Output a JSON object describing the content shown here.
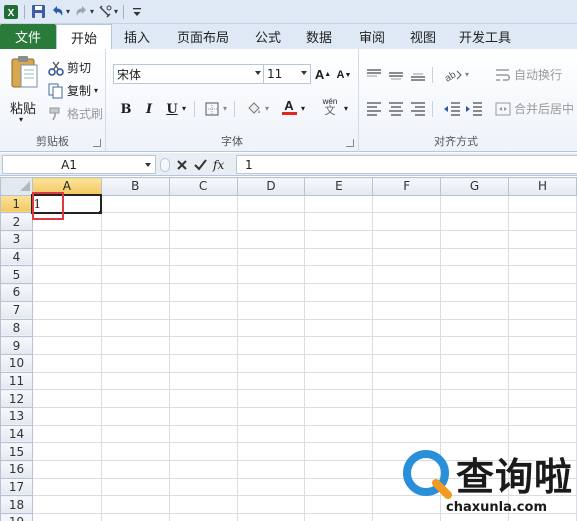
{
  "qat": {
    "icons": [
      "excel-logo-icon",
      "save-icon",
      "undo-icon",
      "redo-icon",
      "format-painter-icon",
      "customize-icon"
    ]
  },
  "tabs": {
    "file": "文件",
    "items": [
      "开始",
      "插入",
      "页面布局",
      "公式",
      "数据",
      "审阅",
      "视图",
      "开发工具"
    ],
    "active": "开始"
  },
  "ribbon": {
    "clipboard": {
      "label": "剪贴板",
      "paste": "粘贴",
      "cut": "剪切",
      "copy": "复制",
      "format_painter": "格式刷"
    },
    "font": {
      "label": "字体",
      "font_name": "宋体",
      "font_size": "11",
      "bold": "B",
      "italic": "I",
      "underline": "U",
      "font_color": "A",
      "wen": "wén"
    },
    "alignment": {
      "label": "对齐方式",
      "wrap_text": "自动换行",
      "merge_center": "合并后居中"
    }
  },
  "formula_bar": {
    "name_box": "A1",
    "fx": "fx",
    "value": "1"
  },
  "sheet": {
    "columns": [
      "A",
      "B",
      "C",
      "D",
      "E",
      "F",
      "G",
      "H"
    ],
    "rows": [
      "1",
      "2",
      "3",
      "4",
      "5",
      "6",
      "7",
      "8",
      "9",
      "10",
      "11",
      "12",
      "13",
      "14",
      "15",
      "16",
      "17",
      "18",
      "19"
    ],
    "active_cell": "A1",
    "a1_value": "1"
  },
  "watermark": {
    "text": "查询啦",
    "url": "chaxunla.com"
  },
  "colors": {
    "file_tab": "#2a7a3a",
    "active_header": "#f4c862",
    "highlight": "#e0383b",
    "font_color_bar": "#e0261f"
  }
}
